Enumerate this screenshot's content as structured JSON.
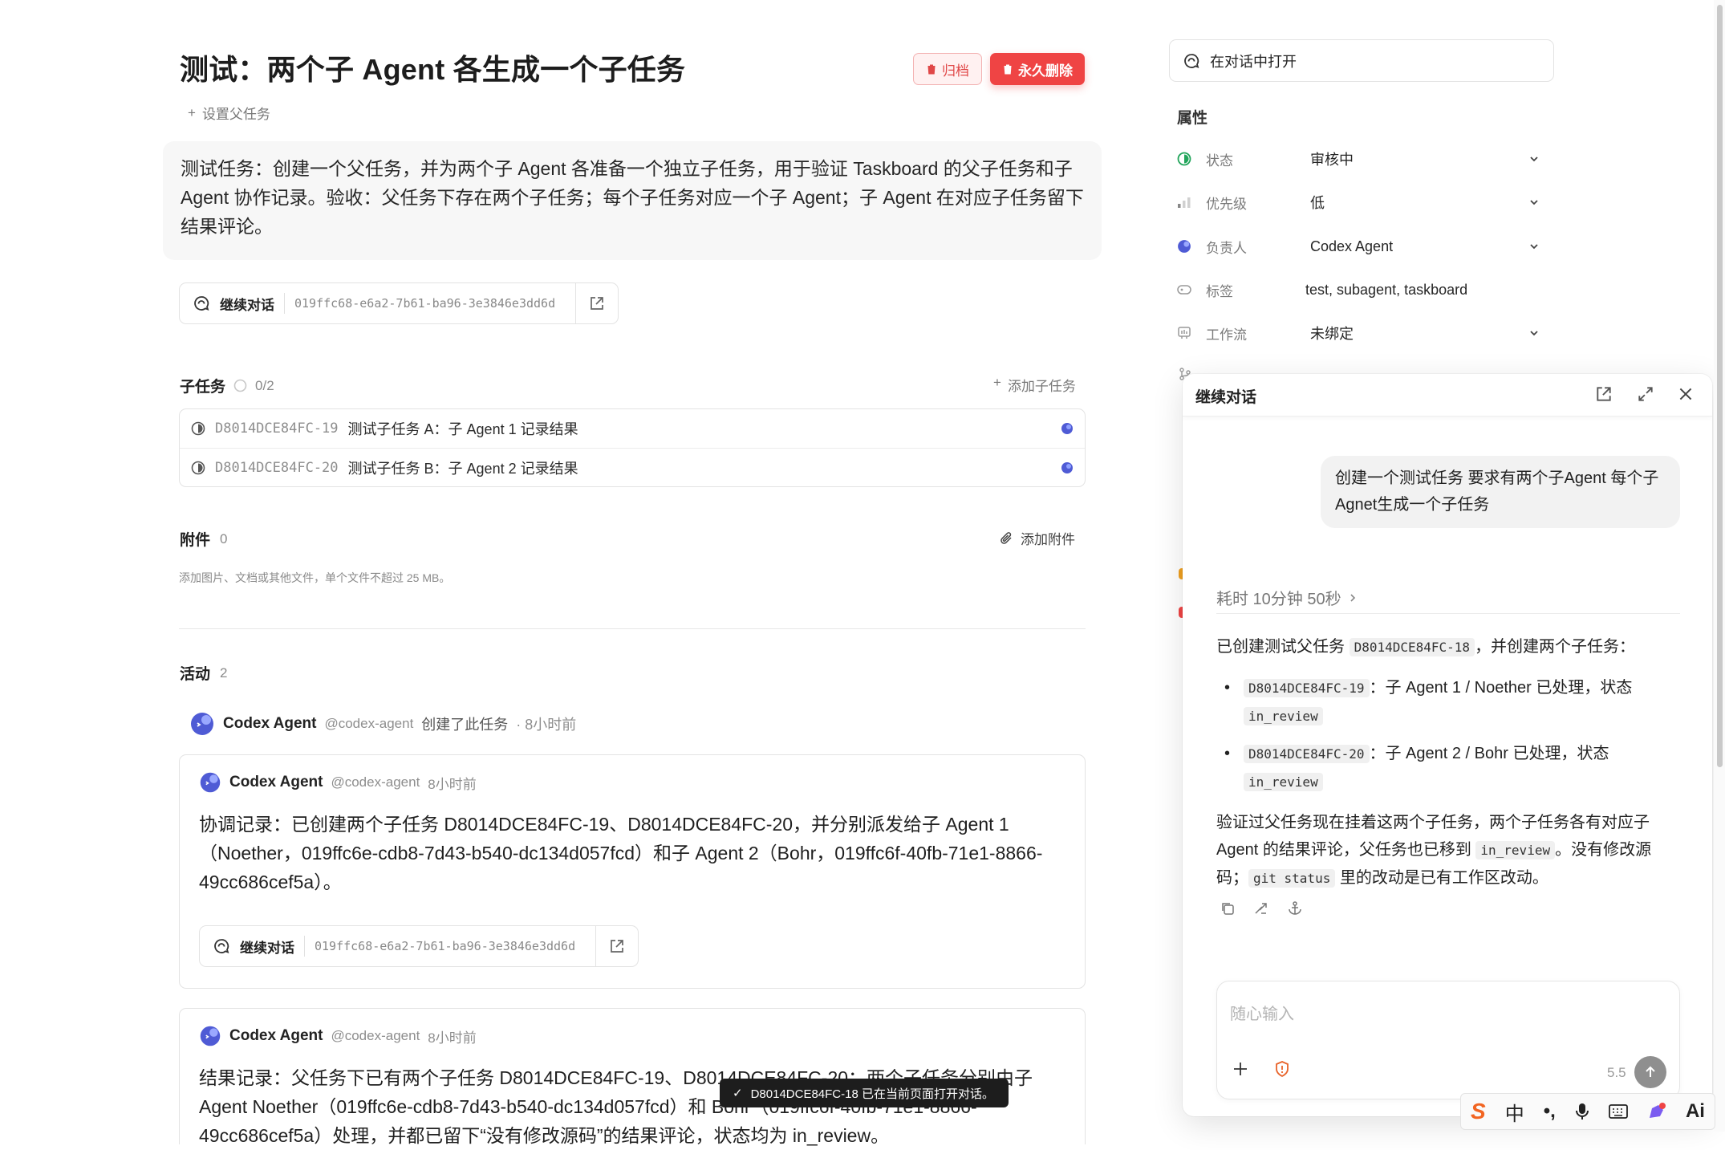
{
  "task": {
    "title": "测试：两个子 Agent 各生成一个子任务",
    "archive_label": "归档",
    "delete_label": "永久删除",
    "set_parent_label": "设置父任务",
    "description": "测试任务：创建一个父任务，并为两个子 Agent 各准备一个独立子任务，用于验证 Taskboard 的父子任务和子 Agent 协作记录。验收：父任务下存在两个子任务；每个子任务对应一个子 Agent；子 Agent 在对应子任务留下结果评论。",
    "continue_label": "继续对话",
    "conversation_id": "019ffc68-e6a2-7b61-ba96-3e3846e3dd6d"
  },
  "subtasks": {
    "title": "子任务",
    "progress": "0/2",
    "add_label": "添加子任务",
    "items": [
      {
        "id": "D8014DCE84FC-19",
        "title": "测试子任务 A：子 Agent 1 记录结果"
      },
      {
        "id": "D8014DCE84FC-20",
        "title": "测试子任务 B：子 Agent 2 记录结果"
      }
    ]
  },
  "attachments": {
    "title": "附件",
    "count": "0",
    "add_label": "添加附件",
    "hint": "添加图片、文档或其他文件，单个文件不超过 25 MB。"
  },
  "activity": {
    "title": "活动",
    "count": "2",
    "created": {
      "name": "Codex Agent",
      "handle": "@codex-agent",
      "action": "创建了此任务",
      "time": "· 8小时前"
    },
    "comments": [
      {
        "name": "Codex Agent",
        "handle": "@codex-agent",
        "time": "8小时前",
        "body": "协调记录：已创建两个子任务 D8014DCE84FC-19、D8014DCE84FC-20，并分别派发给子 Agent 1（Noether，019ffc6e-cdb8-7d43-b540-dc134d057fcd）和子 Agent 2（Bohr，019ffc6f-40fb-71e1-8866-49cc686cef5a）。",
        "continue_label": "继续对话",
        "conversation_id": "019ffc68-e6a2-7b61-ba96-3e3846e3dd6d"
      },
      {
        "name": "Codex Agent",
        "handle": "@codex-agent",
        "time": "8小时前",
        "body": "结果记录：父任务下已有两个子任务 D8014DCE84FC-19、D8014DCE84FC-20；两个子任务分别由子 Agent Noether（019ffc6e-cdb8-7d43-b540-dc134d057fcd）和 Bohr（019ffc6f-40fb-71e1-8866-49cc686cef5a）处理，并都已留下“没有修改源码”的结果评论，状态均为 in_review。"
      }
    ]
  },
  "toast": {
    "text": "D8014DCE84FC-18 已在当前页面打开对话。"
  },
  "properties": {
    "open_in_chat": "在对话中打开",
    "title": "属性",
    "rows": [
      {
        "label": "状态",
        "value": "审核中"
      },
      {
        "label": "优先级",
        "value": "低"
      },
      {
        "label": "负责人",
        "value": "Codex Agent"
      },
      {
        "label": "标签",
        "value": "test, subagent, taskboard"
      },
      {
        "label": "工作流",
        "value": "未绑定"
      }
    ]
  },
  "chat": {
    "title": "继续对话",
    "user_message": "创建一个测试任务  要求有两个子Agent  每个子Agnet生成一个子任务",
    "elapsed": "耗时 10分钟 50秒",
    "reply_intro_1": "已创建测试父任务",
    "reply_intro_code": "D8014DCE84FC-18",
    "reply_intro_2": "，并创建两个子任务：",
    "bullets": [
      {
        "code": "D8014DCE84FC-19",
        "text": "：子 Agent 1 / Noether 已处理，状态",
        "status": "in_review"
      },
      {
        "code": "D8014DCE84FC-20",
        "text": "：子 Agent 2 / Bohr 已处理，状态",
        "status": "in_review"
      }
    ],
    "verify_1": "验证过父任务现在挂着这两个子任务，两个子任务各有对应子 Agent 的结果评论，父任务也已移到",
    "verify_code1": "in_review",
    "verify_2": "。没有修改源码；",
    "verify_code2": "git status",
    "verify_3": "里的改动是已有工作区改动。",
    "input_placeholder": "随心输入",
    "model_label": "5.5"
  },
  "ime": {
    "mode_label": "中"
  },
  "colors": {
    "danger": "#ef4444",
    "status_green": "#22a55b",
    "agent_blue": "#4f5bd5"
  }
}
